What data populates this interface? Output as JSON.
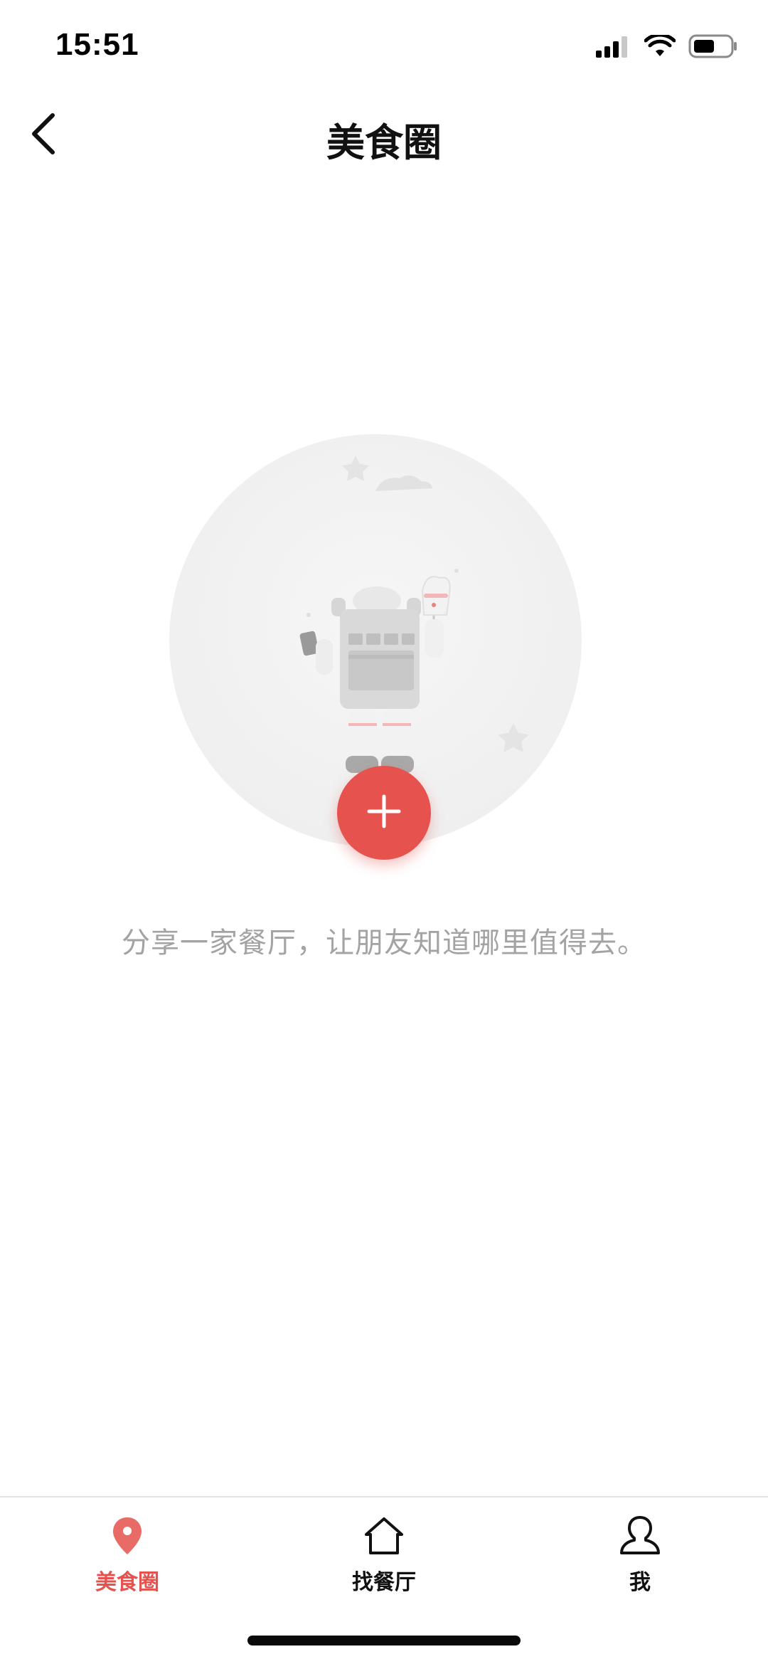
{
  "status_bar": {
    "time": "15:51",
    "icons": [
      "cellular-signal-icon",
      "wifi-icon",
      "battery-icon"
    ]
  },
  "nav": {
    "back_icon": "chevron-left-icon",
    "title": "美食圈"
  },
  "empty_state": {
    "illustration": "astronaut-illustration",
    "add_icon": "plus-icon",
    "message": "分享一家餐厅，让朋友知道哪里值得去。"
  },
  "tabs": [
    {
      "label": "美食圈",
      "icon": "location-pin-icon",
      "active": true
    },
    {
      "label": "找餐厅",
      "icon": "home-icon",
      "active": false
    },
    {
      "label": "我",
      "icon": "user-icon",
      "active": false
    }
  ],
  "colors": {
    "accent": "#e6534f",
    "text_primary": "#111111",
    "text_secondary": "#a3a3a3"
  }
}
